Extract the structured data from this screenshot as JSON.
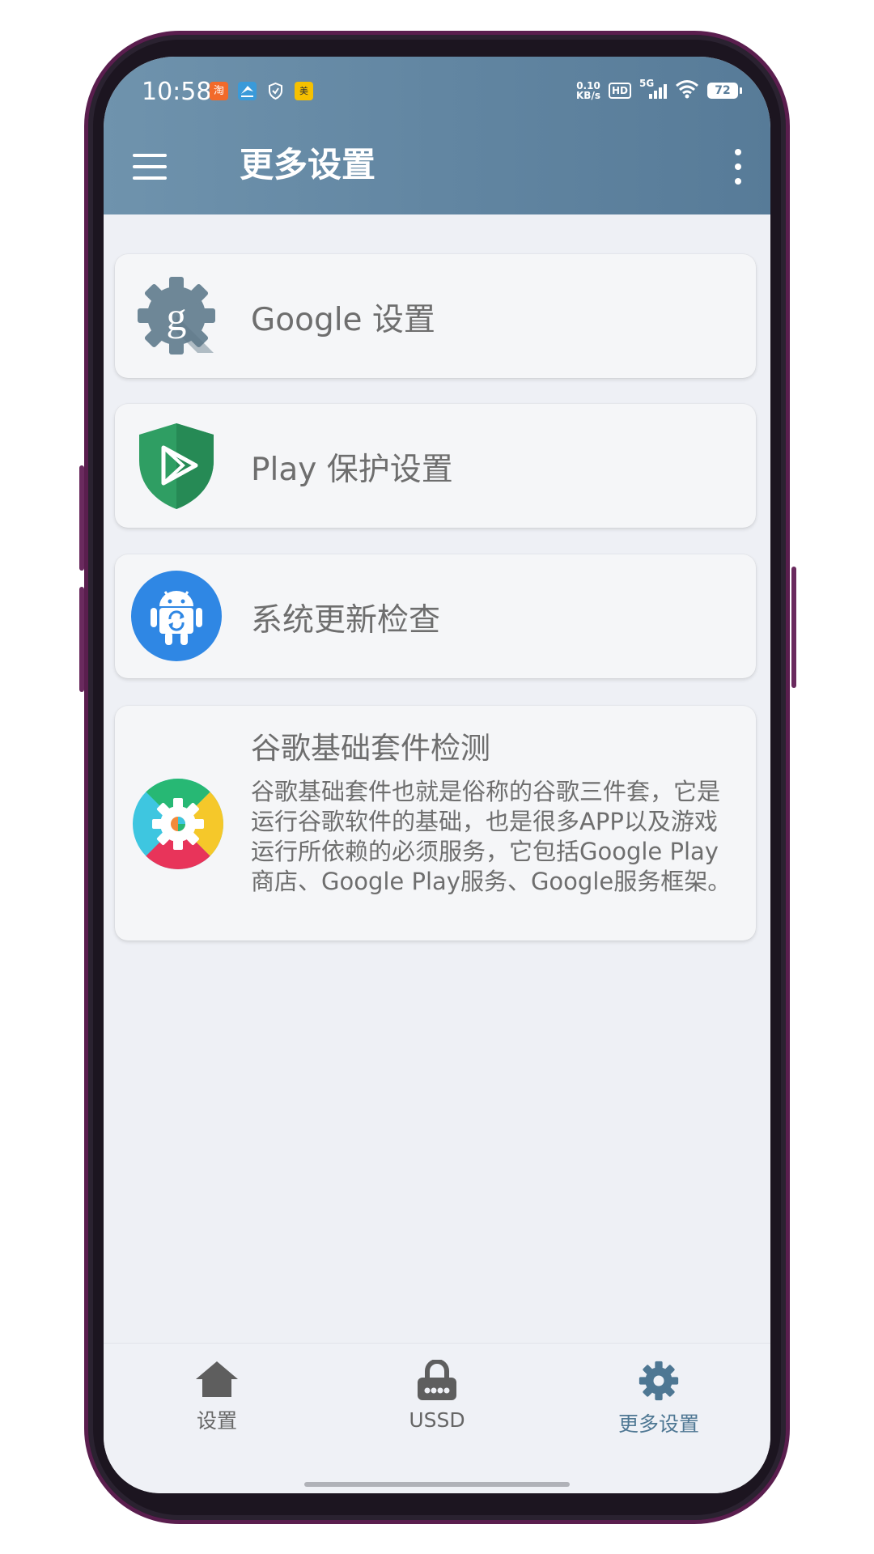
{
  "status_bar": {
    "time": "10:58",
    "notifications": [
      {
        "name": "taobao-icon",
        "glyph": "淘",
        "color": "#f26a2a"
      },
      {
        "name": "map-app-icon",
        "glyph": "",
        "color": "#3a9ad9"
      },
      {
        "name": "shield-notification-icon",
        "glyph": "",
        "color": ""
      },
      {
        "name": "meituan-icon",
        "glyph": "美",
        "color": "#f5c000"
      }
    ],
    "net_speed_value": "0.10",
    "net_speed_unit": "KB/s",
    "hd_label": "HD",
    "network_label": "5G",
    "battery": "72"
  },
  "appbar": {
    "title": "更多设置",
    "background": "#6286a2"
  },
  "cards": [
    {
      "title": "Google 设置",
      "icon": "google-gear-icon"
    },
    {
      "title": "Play 保护设置",
      "icon": "play-protect-shield-icon"
    },
    {
      "title": "系统更新检查",
      "icon": "android-update-icon"
    },
    {
      "title": "谷歌基础套件检测",
      "description": "谷歌基础套件也就是俗称的谷歌三件套，它是运行谷歌软件的基础，也是很多APP以及游戏运行所依赖的必须服务，它包括Google Play商店、Google Play服务、Google服务框架。",
      "icon": "gms-colorful-gear-icon"
    }
  ],
  "bottom_nav": {
    "items": [
      {
        "label": "设置",
        "icon": "home-icon",
        "active": false
      },
      {
        "label": "USSD",
        "icon": "lock-icon",
        "active": false
      },
      {
        "label": "更多设置",
        "icon": "gear-icon",
        "active": true
      }
    ],
    "active_color": "#4e7793"
  }
}
